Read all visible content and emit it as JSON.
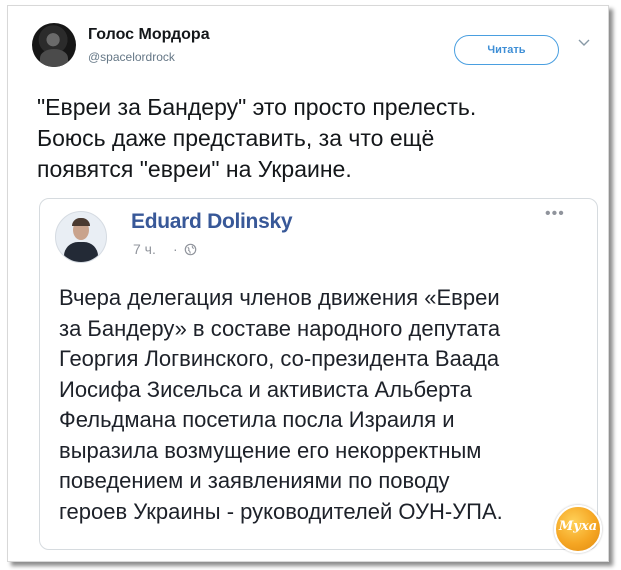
{
  "tweet": {
    "author_name": "Голос Мордора",
    "author_handle": "@spacelordrock",
    "follow_label": "Читать",
    "text_lines": [
      "\"Евреи за Бандеру\" это просто прелесть.",
      "Боюсь даже представить, за что ещё",
      "появятся \"евреи\" на Украине."
    ]
  },
  "embedded_post": {
    "author_name": "Eduard Dolinsky",
    "time": "7 ч.",
    "separator": "·",
    "more_label": "•••",
    "body_lines": [
      "Вчера делегация членов движения «Евреи",
      "за Бандеру» в составе народного депутата",
      "Георгия Логвинского, со-президента Ваада",
      "Иосифа Зисельса и активиста Альберта",
      "Фельдмана посетила посла Израиля и",
      "выразила возмущение его некорректным",
      "поведением и заявлениями по поводу",
      "героев Украины - руководителей ОУН-УПА."
    ]
  },
  "watermark": {
    "text": "Муха"
  },
  "colors": {
    "accent": "#1da1f2",
    "fb_name": "#385898",
    "text": "#14171a",
    "muted": "#657786"
  }
}
